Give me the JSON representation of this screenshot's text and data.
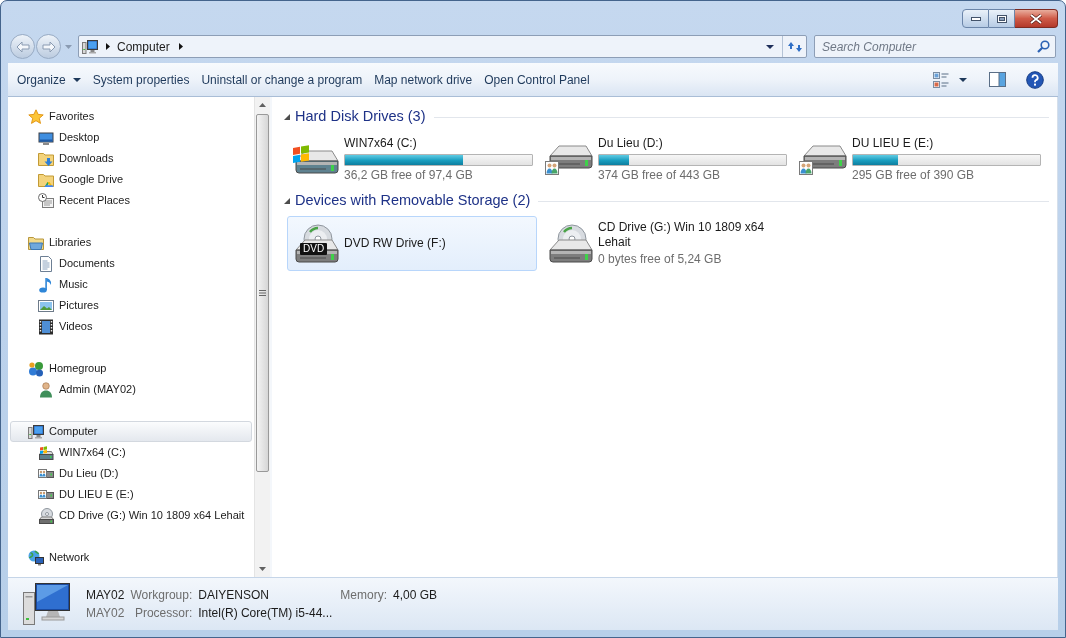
{
  "address_bar": {
    "crumbs": [
      "Computer"
    ]
  },
  "search": {
    "placeholder": "Search Computer"
  },
  "toolbar": {
    "items": [
      {
        "label": "Organize",
        "kind": "menu"
      },
      {
        "label": "System properties",
        "kind": "button"
      },
      {
        "label": "Uninstall or change a program",
        "kind": "button"
      },
      {
        "label": "Map network drive",
        "kind": "button"
      },
      {
        "label": "Open Control Panel",
        "kind": "button"
      }
    ]
  },
  "sidebar": {
    "groups": [
      {
        "label": "Favorites",
        "selected": false,
        "children": [
          {
            "label": "Desktop",
            "selected": false
          },
          {
            "label": "Downloads",
            "selected": false
          },
          {
            "label": "Google Drive",
            "selected": false
          },
          {
            "label": "Recent Places",
            "selected": false
          }
        ]
      },
      {
        "label": "Libraries",
        "selected": false,
        "children": [
          {
            "label": "Documents",
            "selected": false
          },
          {
            "label": "Music",
            "selected": false
          },
          {
            "label": "Pictures",
            "selected": false
          },
          {
            "label": "Videos",
            "selected": false
          }
        ]
      },
      {
        "label": "Homegroup",
        "selected": false,
        "children": [
          {
            "label": "Admin (MAY02)",
            "selected": false
          }
        ]
      },
      {
        "label": "Computer",
        "selected": true,
        "children": [
          {
            "label": "WIN7x64 (C:)",
            "selected": false
          },
          {
            "label": "Du Lieu (D:)",
            "selected": false
          },
          {
            "label": "DU LIEU E (E:)",
            "selected": false
          },
          {
            "label": "CD Drive (G:) Win 10 1809 x64 Lehait",
            "selected": false
          }
        ]
      },
      {
        "label": "Network",
        "selected": false
      }
    ]
  },
  "sections": [
    {
      "title": "Hard Disk Drives (3)",
      "expanded": true,
      "items": [
        {
          "name": "WIN7x64 (C:)",
          "level": 0.63,
          "free": "36,2 GB free of 97,4 GB",
          "selected": false
        },
        {
          "name": "Du Lieu (D:)",
          "level": 0.16,
          "free": "374 GB free of 443 GB",
          "selected": false
        },
        {
          "name": "DU LIEU E (E:)",
          "level": 0.24,
          "free": "295 GB free of 390 GB",
          "selected": false
        }
      ]
    },
    {
      "title": "Devices with Removable Storage (2)",
      "expanded": true,
      "items": [
        {
          "name": "DVD RW Drive (F:)",
          "icon_label": "DVD",
          "selected": true
        },
        {
          "name": "CD Drive (G:) Win 10 1809 x64 Lehait",
          "free": "0 bytes free of 5,24 GB",
          "selected": false
        }
      ]
    }
  ],
  "details": {
    "name": "MAY02",
    "description": "MAY02",
    "fields": [
      {
        "label": "Workgroup:",
        "value": "DAIYENSON"
      },
      {
        "label": "Processor:",
        "value": "Intel(R) Core(TM) i5-44..."
      },
      {
        "label": "Memory:",
        "value": "4,00 GB"
      }
    ]
  }
}
